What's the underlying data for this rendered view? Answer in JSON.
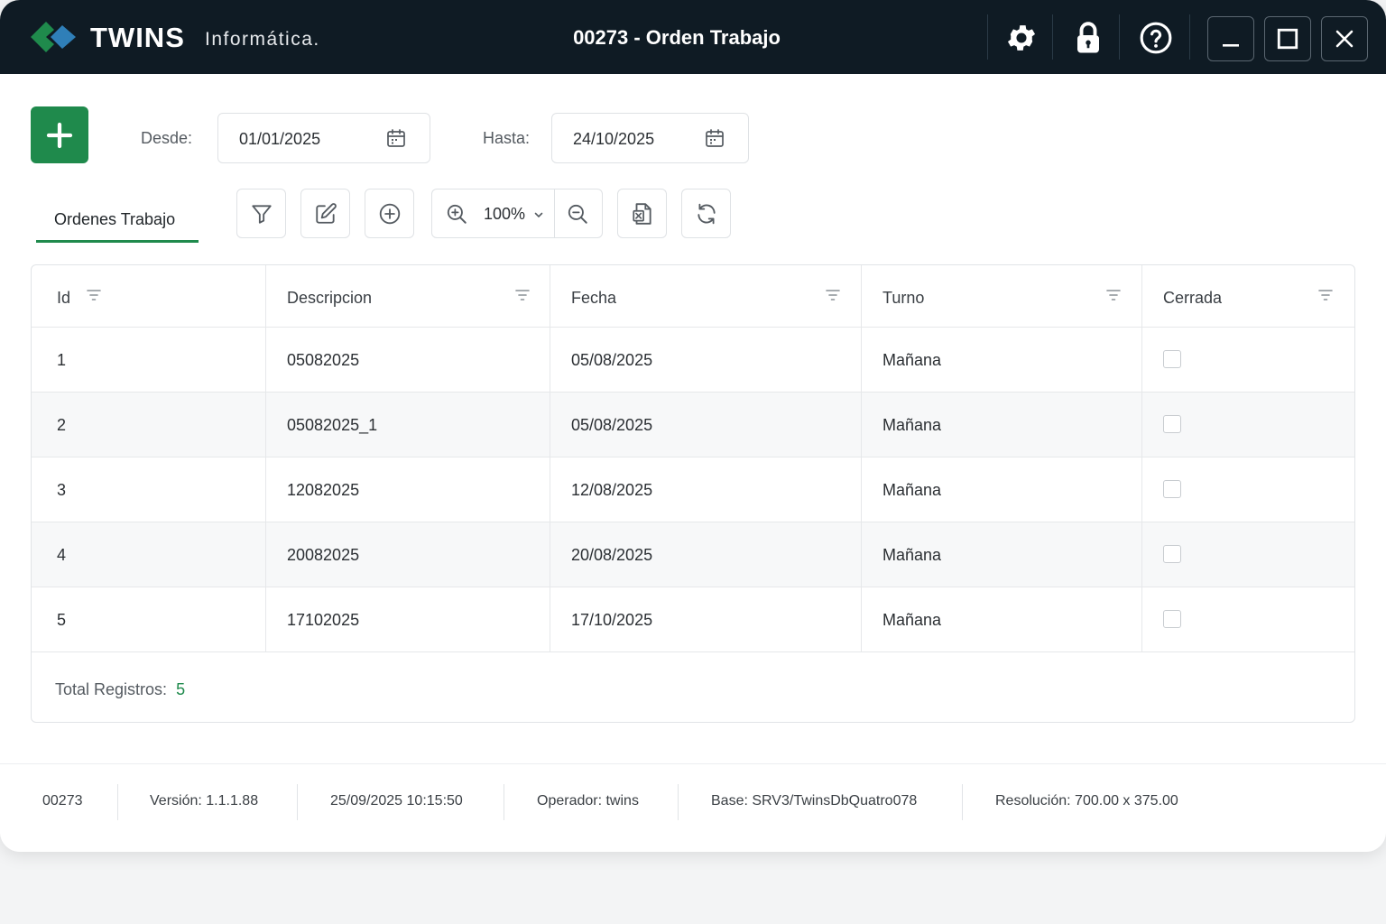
{
  "app": {
    "brand": "TWINS",
    "brand_sub": "Informática.",
    "window_title": "00273 - Orden Trabajo",
    "icons": [
      "gear-icon",
      "lock-icon",
      "help-icon",
      "minimize-icon",
      "maximize-icon",
      "close-icon"
    ],
    "colors": {
      "titlebar": "#0f1b24",
      "accent": "#1f8a4c"
    }
  },
  "filters": {
    "desde_label": "Desde:",
    "desde_value": "01/01/2025",
    "hasta_label": "Hasta:",
    "hasta_value": "24/10/2025"
  },
  "tabs": [
    {
      "label": "Ordenes Trabajo",
      "active": true
    }
  ],
  "toolbar": {
    "zoom_value": "100%",
    "icons": [
      "filter-icon",
      "edit-icon",
      "add-circle-icon",
      "zoom-in-icon",
      "zoom-out-icon",
      "excel-export-icon",
      "refresh-icon"
    ]
  },
  "table": {
    "columns": [
      "Id",
      "Descripcion",
      "Fecha",
      "Turno",
      "Cerrada"
    ],
    "rows": [
      {
        "id": "1",
        "descripcion": "05082025",
        "fecha": "05/08/2025",
        "turno": "Mañana",
        "cerrada": false
      },
      {
        "id": "2",
        "descripcion": "05082025_1",
        "fecha": "05/08/2025",
        "turno": "Mañana",
        "cerrada": false
      },
      {
        "id": "3",
        "descripcion": "12082025",
        "fecha": "12/08/2025",
        "turno": "Mañana",
        "cerrada": false
      },
      {
        "id": "4",
        "descripcion": "20082025",
        "fecha": "20/08/2025",
        "turno": "Mañana",
        "cerrada": false
      },
      {
        "id": "5",
        "descripcion": "17102025",
        "fecha": "17/10/2025",
        "turno": "Mañana",
        "cerrada": false
      }
    ],
    "total_label": "Total Registros:",
    "total_value": "5"
  },
  "status_bar": {
    "code": "00273",
    "version": "Versión: 1.1.1.88",
    "datetime": "25/09/2025 10:15:50",
    "operador": "Operador: twins",
    "base": "Base: SRV3/TwinsDbQuatro078",
    "resolucion": "Resolución: 700.00 x 375.00"
  }
}
